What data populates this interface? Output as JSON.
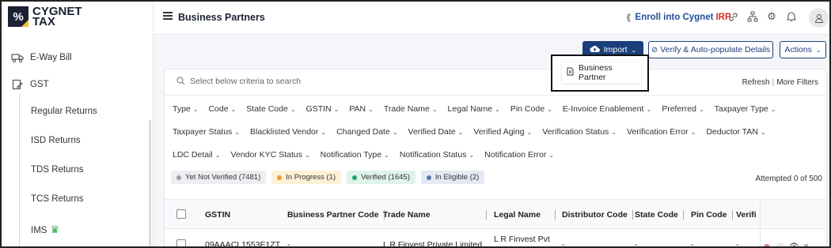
{
  "logo": {
    "mark": "%",
    "line1": "CYGNET",
    "line2": "TAX"
  },
  "sidebar": {
    "items": [
      {
        "label": "E-Way Bill",
        "icon": "truck-icon"
      },
      {
        "label": "GST",
        "icon": "document-edit-icon"
      }
    ],
    "sub_items": [
      {
        "label": "Regular Returns"
      },
      {
        "label": "ISD Returns"
      },
      {
        "label": "TDS Returns"
      },
      {
        "label": "TCS Returns"
      },
      {
        "label": "IMS",
        "icon": "crown-icon"
      }
    ]
  },
  "header": {
    "title": "Business Partners",
    "enroll_label": "Enroll into Cygnet",
    "enroll_highlight": "IRP",
    "icons": [
      "link-icon",
      "sitemap-icon",
      "gear-icon",
      "bell-icon",
      "user-icon"
    ]
  },
  "toolbar": {
    "import_label": "Import",
    "verify_label": "Verify & Auto-populate Details",
    "actions_label": "Actions"
  },
  "import_menu": {
    "items": [
      {
        "label": "Business Partner",
        "icon": "file-icon"
      }
    ]
  },
  "search": {
    "placeholder": "Select below criteria to search",
    "refresh_label": "Refresh",
    "more_filters_label": "More Filters"
  },
  "filters": {
    "row1": [
      "Type",
      "Code",
      "State Code",
      "GSTIN",
      "PAN",
      "Trade Name",
      "Legal Name",
      "Pin Code",
      "E-Invoice Enablement",
      "Preferred",
      "Taxpayer Type"
    ],
    "row2": [
      "Taxpayer Status",
      "Blacklisted Vendor",
      "Changed Date",
      "Verified Date",
      "Verified Aging",
      "Verification Status",
      "Verification Error",
      "Deductor TAN"
    ],
    "row3": [
      "LDC Detail",
      "Vendor KYC Status",
      "Notification Type",
      "Notification Status",
      "Notification Error"
    ]
  },
  "status_chips": [
    {
      "label": "Yet Not Verified (7481)",
      "bg": "#eceef1",
      "dot": "#9aa0a6"
    },
    {
      "label": "In Progress (1)",
      "bg": "#fdf1d8",
      "dot": "#f0a020"
    },
    {
      "label": "Verified (1645)",
      "bg": "#dff3ea",
      "dot": "#1aa36b"
    },
    {
      "label": "In Eligible (2)",
      "bg": "#e4e9f3",
      "dot": "#5a7bb0"
    }
  ],
  "attempted": "Attempted 0 of 500",
  "table": {
    "columns": [
      "GSTIN",
      "Business Partner Code",
      "Trade Name",
      "Legal Name",
      "Distributor Code",
      "State Code",
      "Pin Code",
      "Verifi"
    ],
    "rows": [
      {
        "gstin": "09AAACL1553E1ZT",
        "bp_code": "-",
        "trade_name": "L R Finvest Private Limited",
        "legal_name": "L R Finvest Pvt",
        "distributor_code": "-",
        "state_code": "-",
        "pin_code": "-",
        "verifi": "-"
      }
    ]
  },
  "colors": {
    "brand_dark": "#1b3f7a",
    "enroll_blue": "#1f4e9c",
    "irp_red": "#d62e2e"
  }
}
